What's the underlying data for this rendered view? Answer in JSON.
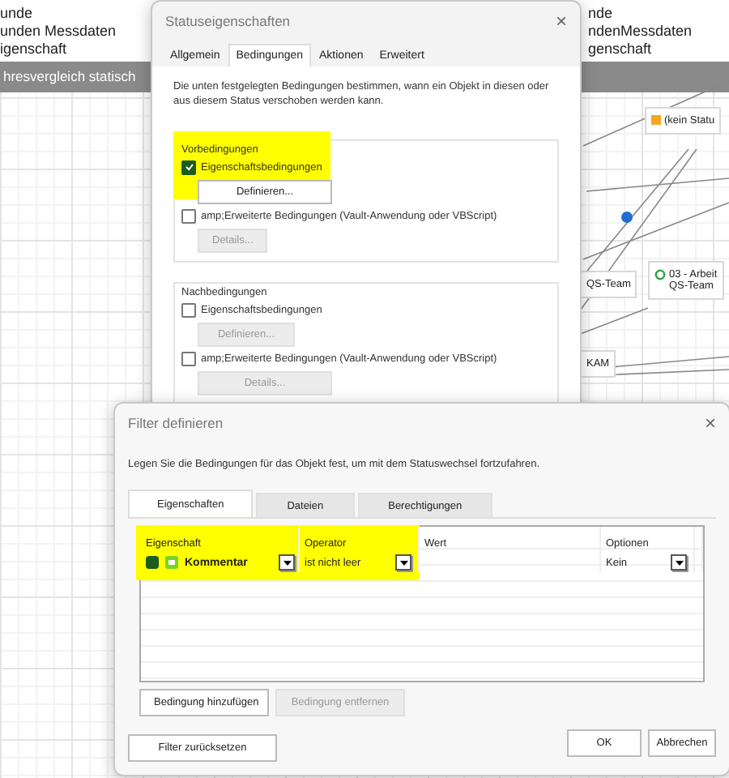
{
  "background": {
    "left_lines": [
      "unde",
      "unden Messdaten",
      "igenschaft"
    ],
    "right_lines": [
      "nde",
      "ndenMessdaten",
      "genschaft"
    ],
    "banner": "hresvergleich statisch",
    "nodes": [
      {
        "kind": "square",
        "lines": [
          "(kein Statu"
        ]
      },
      {
        "kind": "plain",
        "lines": [
          "QS-Team"
        ]
      },
      {
        "kind": "ring",
        "lines": [
          "03 - Arbeit",
          "QS-Team"
        ]
      },
      {
        "kind": "plain",
        "lines": [
          "KAM"
        ]
      }
    ]
  },
  "status_dialog": {
    "title": "Statuseigenschaften",
    "close": "×",
    "tabs": [
      {
        "label": "Allgemein",
        "selected": false
      },
      {
        "label": "Bedingungen",
        "selected": true
      },
      {
        "label": "Aktionen",
        "selected": false
      },
      {
        "label": "Erweitert",
        "selected": false
      }
    ],
    "description": "Die unten festgelegten Bedingungen bestimmen, wann ein Objekt in diesen oder aus diesem Status verschoben werden kann.",
    "groups": [
      {
        "title": "Vorbedingungen",
        "highlighted": true,
        "options": [
          {
            "label": "Eigenschaftsbedingungen",
            "checked": true,
            "button": {
              "label": "Definieren...",
              "disabled": false
            }
          },
          {
            "label": "amp;Erweiterte Bedingungen (Vault-Anwendung oder VBScript)",
            "checked": false,
            "button": {
              "label": "Details...",
              "disabled": true
            }
          }
        ]
      },
      {
        "title": "Nachbedingungen",
        "highlighted": false,
        "options": [
          {
            "label": "Eigenschaftsbedingungen",
            "checked": false,
            "button": {
              "label": "Definieren...",
              "disabled": true
            }
          },
          {
            "label": "amp;Erweiterte Bedingungen (Vault-Anwendung oder VBScript)",
            "checked": false,
            "button": {
              "label": "Details...",
              "disabled": true
            }
          }
        ]
      }
    ]
  },
  "filter_dialog": {
    "title": "Filter definieren",
    "close": "×",
    "description": "Legen Sie die Bedingungen für das Objekt fest, um mit dem Statuswechsel fortzufahren.",
    "tabs": [
      {
        "label": "Eigenschaften",
        "selected": true
      },
      {
        "label": "Dateien",
        "selected": false
      },
      {
        "label": "Berechtigungen",
        "selected": false
      }
    ],
    "table": {
      "highlighted": true,
      "columns": [
        "Eigenschaft",
        "Operator",
        "Wert",
        "Optionen"
      ],
      "rows": [
        {
          "property": "Kommentar",
          "operator": "ist nicht leer",
          "options": "Kein"
        }
      ]
    },
    "buttons": [
      {
        "label": "Bedingung hinzufügen",
        "disabled": false
      },
      {
        "label": "Bedingung entfernen",
        "disabled": true
      }
    ],
    "footer_left": [
      {
        "label": "Filter zurücksetzen"
      }
    ],
    "footer_right": [
      {
        "label": "OK"
      },
      {
        "label": "Abbrechen"
      }
    ]
  }
}
